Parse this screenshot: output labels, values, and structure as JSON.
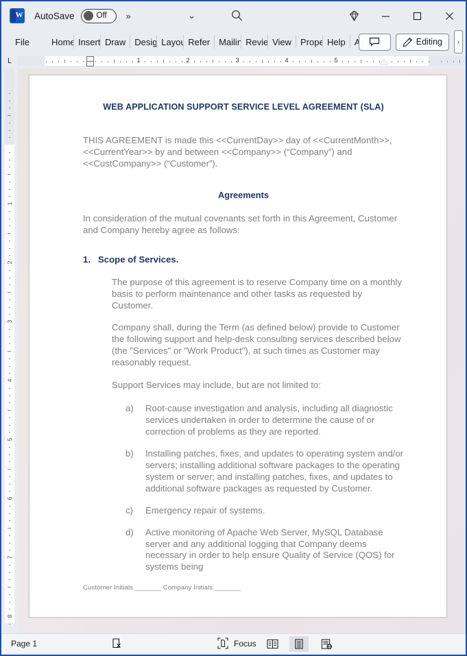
{
  "window": {
    "app_logo": "word-logo",
    "autosave_label": "AutoSave",
    "autosave_state": "Off",
    "overflow_glyph": "»",
    "chevron_glyph": "⌄",
    "search_icon": "search-icon",
    "diamond_icon": "diamond-icon",
    "minimize_glyph": "—",
    "maximize_glyph": "▢",
    "close_glyph": "✕"
  },
  "ribbon": {
    "tabs": [
      {
        "label": "File"
      },
      {
        "label": "Home"
      },
      {
        "label": "Insert"
      },
      {
        "label": "Draw"
      },
      {
        "label": "Design"
      },
      {
        "label": "Layout"
      },
      {
        "label": "Refer"
      },
      {
        "label": "Mailings"
      },
      {
        "label": "Review"
      },
      {
        "label": "View"
      },
      {
        "label": "Proper"
      },
      {
        "label": "Help"
      },
      {
        "label": "Acrobat"
      }
    ],
    "comment_button": "comment-icon",
    "editing_label": "Editing",
    "editing_more_glyph": "›"
  },
  "ruler": {
    "corner_label": "L",
    "horizontal_numbers": [
      "1",
      "2",
      "3",
      "4",
      "5"
    ],
    "vertical_numbers": [
      "1",
      "2",
      "3",
      "4",
      "5",
      "6",
      "7",
      "8"
    ]
  },
  "document": {
    "title": "WEB APPLICATION SUPPORT SERVICE LEVEL AGREEMENT (SLA)",
    "intro": "THIS AGREEMENT is made this <<CurrentDay>> day of <<CurrentMonth>>, <<CurrentYear>> by and between <<Company>> (“Company”) and <<CustCompany>> (“Customer”).",
    "agreements_heading": "Agreements",
    "consideration": "In consideration of the mutual covenants set forth in this Agreement, Customer and Company hereby agree as follows:",
    "section_number": "1.",
    "section_title": "Scope of Services.",
    "purpose_para": "The purpose of this agreement is to reserve Company time on a monthly basis to perform maintenance and other tasks as requested by Customer.",
    "company_shall_para": "Company shall, during the Term (as defined below) provide to Customer the following support and help-desk consulting services described below (the \"Services\" or \"Work Product\"), at such times as Customer may reasonably request.",
    "support_lead": "Support Services may include, but are not limited to:",
    "items": [
      {
        "marker": "a)",
        "text": "Root-cause investigation and analysis, including all diagnostic services undertaken in order to determine the cause of or correction of problems as they are reported."
      },
      {
        "marker": "b)",
        "text": "Installing patches, fixes, and updates to operating system and/or servers; installing additional software packages to the operating system or server; and installing patches, fixes, and updates to additional software packages as requested by Customer."
      },
      {
        "marker": "c)",
        "text": "Emergency repair of systems."
      },
      {
        "marker": "d)",
        "text": "Active monitoring of Apache Web Server, MySQL Database server and any additional logging that Company deems necessary in order to help ensure Quality of Service (QOS) for systems being"
      }
    ],
    "footer_initials": "Customer Initials _______  Company Initials _______"
  },
  "statusbar": {
    "page_label": "Page 1",
    "accessibility_icon": "accessibility-check-icon",
    "focus_label": "Focus",
    "focus_icon": "focus-icon",
    "view_read_icon": "read-mode-icon",
    "view_print_icon": "print-layout-icon",
    "view_web_icon": "web-layout-icon"
  },
  "colors": {
    "accent_blue": "#1a4fb4",
    "heading_navy": "#1f3864",
    "body_gray": "#808080",
    "chrome": "#e9edf2"
  }
}
